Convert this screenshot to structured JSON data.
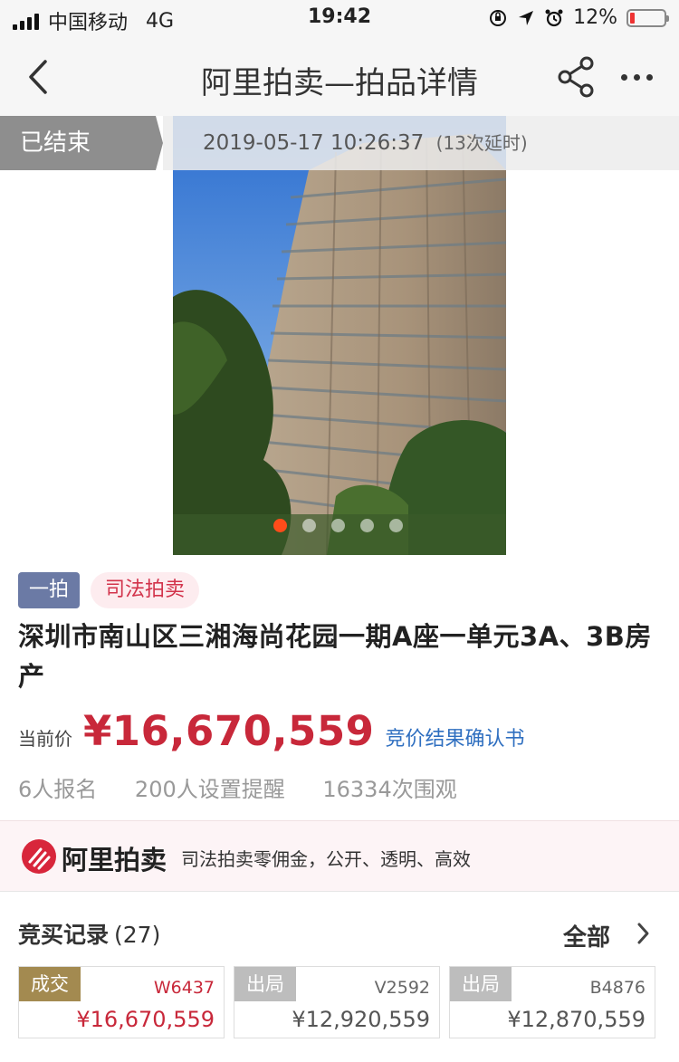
{
  "status_bar": {
    "carrier": "中国移动",
    "network": "4G",
    "time": "19:42",
    "battery_percent": "12%",
    "battery_level": 0.12
  },
  "nav": {
    "title": "阿里拍卖—拍品详情"
  },
  "auction_status": {
    "status_label": "已结束",
    "end_time": "2019-05-17 10:26:37",
    "extension_note": "(13次延时)"
  },
  "gallery": {
    "total_images": 5,
    "active_index": 0
  },
  "item": {
    "round_tag": "一拍",
    "type_tag": "司法拍卖",
    "title": "深圳市南山区三湘海尚花园一期A座一单元3A、3B房产",
    "price_label": "当前价",
    "price": "¥16,670,559",
    "price_link": "竞价结果确认书",
    "stats": {
      "registered": "6人报名",
      "reminders": "200人设置提醒",
      "views": "16334次围观"
    }
  },
  "banner": {
    "logo_text": "阿里拍卖",
    "slogan": "司法拍卖零佣金，公开、透明、高效"
  },
  "bid_records": {
    "title": "竞买记录",
    "count": "(27)",
    "view_all": "全部",
    "records": [
      {
        "status": "成交",
        "bidder": "W6437",
        "amount": "¥16,670,559"
      },
      {
        "status": "出局",
        "bidder": "V2592",
        "amount": "¥12,920,559"
      },
      {
        "status": "出局",
        "bidder": "B4876",
        "amount": "¥12,870,559"
      }
    ]
  },
  "colors": {
    "price_red": "#c8283a",
    "link_blue": "#2f6fc0",
    "deal_gold": "#a38a50",
    "out_gray": "#bdbdbd",
    "tag_blue": "#6b7aa5"
  }
}
